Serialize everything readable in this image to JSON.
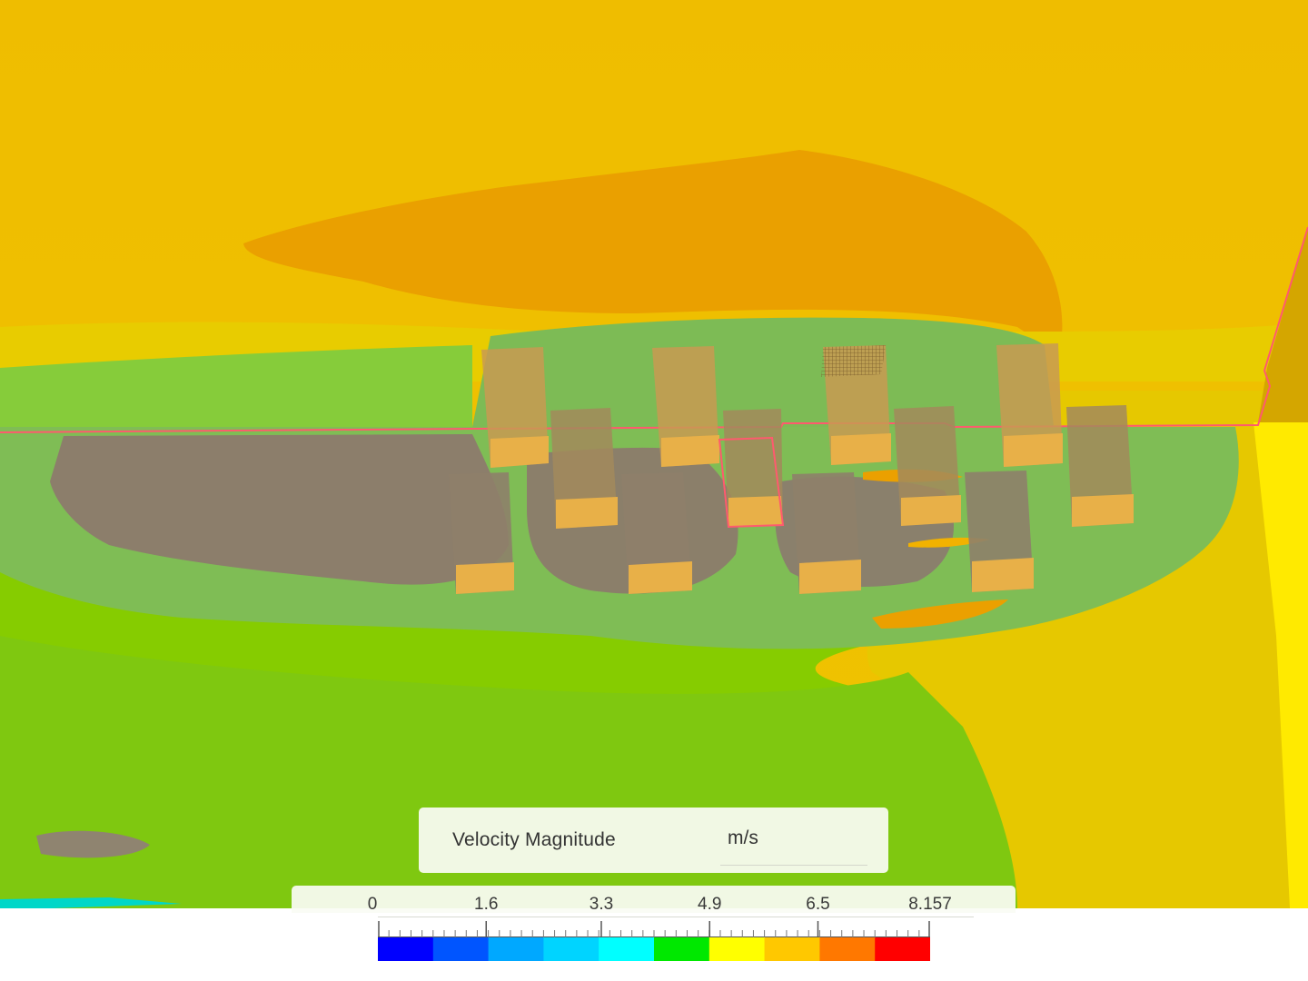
{
  "legend": {
    "title": "Velocity Magnitude",
    "unit": "m/s",
    "min": 0,
    "max": 8.157,
    "tick_labels": [
      "0",
      "1.6",
      "3.3",
      "4.9",
      "6.5",
      "8.157"
    ],
    "tick_values": [
      0,
      1.6,
      3.3,
      4.9,
      6.5,
      8.157
    ],
    "colormap": [
      "#0000ff",
      "#0055ff",
      "#00a8ff",
      "#00d4ff",
      "#00ffff",
      "#00e800",
      "#ffff00",
      "#ffc800",
      "#ff7800",
      "#ff0000"
    ]
  },
  "scene": {
    "colors": {
      "far_field": "#ecbd00",
      "wake_high": "#eaa100",
      "wake_mid": "#e8ce00",
      "ground_green": "#86cc00",
      "low_speed": "#7fc04a",
      "shadow": "#8d7f69",
      "building": "#c89a52",
      "building_roof": "#e7b04a",
      "selection": "#ff5a6e"
    }
  }
}
